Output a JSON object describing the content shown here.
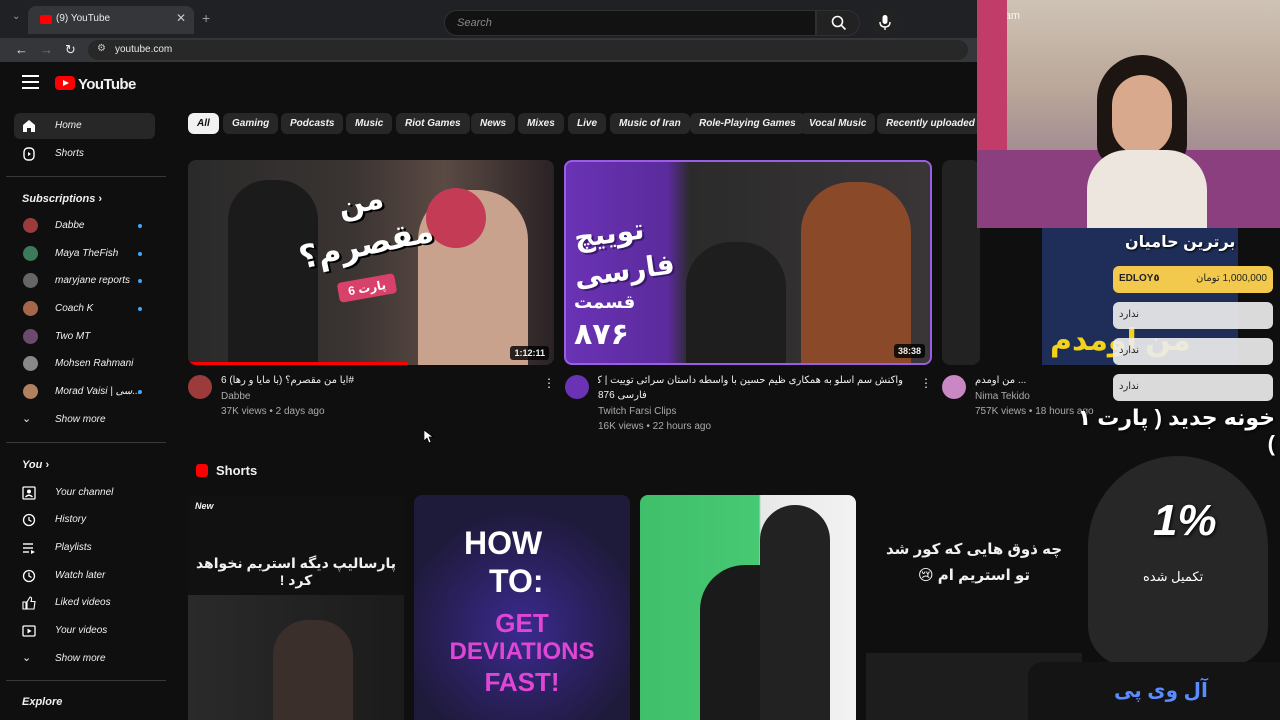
{
  "browser": {
    "tab_title": "(9) YouTube",
    "url": "youtube.com"
  },
  "header": {
    "logo_text": "YouTube",
    "search_placeholder": "Search"
  },
  "sidebar": {
    "main": [
      {
        "label": "Home",
        "icon": "home-icon",
        "active": true
      },
      {
        "label": "Shorts",
        "icon": "shorts-icon"
      }
    ],
    "subscriptions_heading": "Subscriptions",
    "subscriptions": [
      {
        "label": "Dabbe",
        "color": "#9b3b3b"
      },
      {
        "label": "Maya TheFish",
        "color": "#3b7a5a"
      },
      {
        "label": "maryjane reports",
        "color": "#666666"
      },
      {
        "label": "Coach K",
        "color": "#a5674a"
      },
      {
        "label": "Two MT",
        "color": "#6b4b6b"
      },
      {
        "label": "Mohsen Rahmani",
        "color": "#888888"
      },
      {
        "label": "Morad Vaisi | سی...",
        "color": "#b08060"
      }
    ],
    "show_more_1": "Show more",
    "you_heading": "You",
    "you_items": [
      {
        "label": "Your channel",
        "icon": "channel-icon"
      },
      {
        "label": "History",
        "icon": "history-icon"
      },
      {
        "label": "Playlists",
        "icon": "playlists-icon"
      },
      {
        "label": "Watch later",
        "icon": "clock-icon"
      },
      {
        "label": "Liked videos",
        "icon": "thumbs-up-icon"
      },
      {
        "label": "Your videos",
        "icon": "play-square-icon"
      }
    ],
    "show_more_2": "Show more",
    "explore_heading": "Explore"
  },
  "chips": [
    "All",
    "Gaming",
    "Podcasts",
    "Music",
    "Riot Games",
    "News",
    "Mixes",
    "Live",
    "Music of Iran",
    "Role-Playing Games",
    "Vocal Music",
    "Recently uploaded"
  ],
  "videos": [
    {
      "title": "آیا من مقصرم؟ (با مایا و رها) 6#",
      "channel": "Dabbe",
      "meta": "37K views • 2 days ago",
      "duration": "1:12:11",
      "thumb_text_1": "من",
      "thumb_text_2": "مقصرم؟",
      "thumb_badge": "پارت 6"
    },
    {
      "title": "واکنش سم اسلو به همکاری ظیم حسین با واسطه داستان سرائی توییت | کیک و توییچ",
      "title_2": "فارسی 876",
      "channel": "Twitch Farsi Clips",
      "meta": "16K views • 22 hours ago",
      "duration": "38:38",
      "thumb_text_1": "توییچ",
      "thumb_text_2": "فارسی",
      "thumb_text_3": "قسمت",
      "thumb_text_4": "۸۷۶"
    },
    {
      "title": "من اومدم ...",
      "channel": "Nima Tekido",
      "meta": "757K views • 18 hours ago",
      "thumb_text_1": "من اومدم"
    }
  ],
  "shorts": {
    "heading": "Shorts",
    "items": [
      {
        "badge": "New",
        "text": "پارسالیپ دیگه استریم نخواهد کرد !"
      },
      {
        "text_1": "HOW",
        "text_2": "TO:",
        "text_3": "GET",
        "text_4": "DEVIATIONS",
        "text_5": "FAST!"
      },
      {},
      {
        "text": "چه ذوق هایی که کور شد تو استریم ام 😢"
      }
    ]
  },
  "overlay": {
    "webcam_label": "iVCam",
    "top_donors_title": "برترین حامیان",
    "donors": [
      {
        "name": "EDLOY٥",
        "amount": "1,000,000 تومان"
      },
      {
        "name": "ندارد"
      },
      {
        "name": "ندارد"
      },
      {
        "name": "ندارد"
      }
    ],
    "subtitle": "خونه جدید ( پارت ۱ )",
    "goal_percent": "1%",
    "goal_label": "تکمیل شده",
    "brand": "آل وی پی"
  }
}
